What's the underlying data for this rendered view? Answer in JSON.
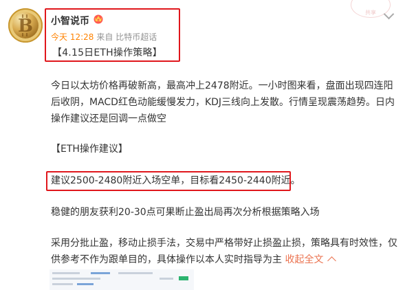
{
  "post": {
    "author": "小智说币",
    "time": "今天 12:28",
    "source": "来自 比特币超话",
    "title": "【4.15日ETH操作策略】",
    "paragraphs": [
      "今日以太坊价格再破新高，最高冲上2478附近。一小时图来看，盘面出现四连阳后收阴，MACD红色动能缓慢发力，KDJ三线向上发散。行情呈现震荡趋势。日内操作建议还是回调一点做空",
      "【ETH操作建议】",
      "建议2500-2480附近入场空单，目标看2450-2440附近。",
      "稳健的朋友获利20-30点可果断止盈出局再次分析根据策略入场",
      "采用分批止盈，移动止损手法，交易中严格带好止损盈止损，策略具有时效性，仅供参考不作为跟单目的，具体操作以本人实时指导为主"
    ],
    "collapse_label": "收起全文"
  },
  "colors": {
    "highlight_box": "#e0161b",
    "time": "#ff8200",
    "link": "#eb7350"
  },
  "icons": [
    "avatar-bitcoin",
    "vip-crown-icon",
    "chevron-down-icon",
    "chevron-up-icon"
  ]
}
